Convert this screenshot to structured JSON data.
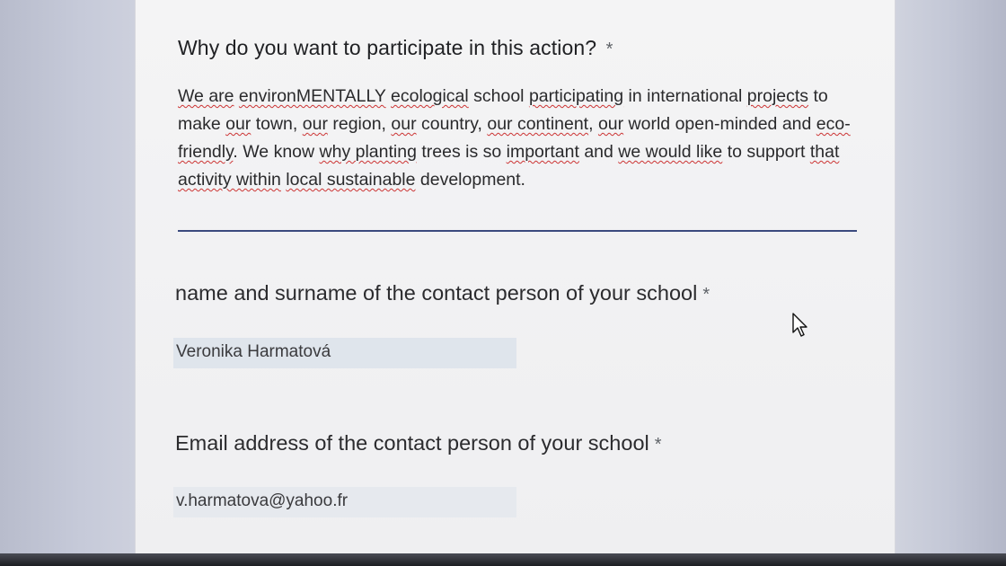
{
  "question": {
    "title": "Why do you want to participate in this action?",
    "required_mark": "*",
    "answer_segments": [
      {
        "t": "We are",
        "sq": true
      },
      {
        "t": " ",
        "sq": false
      },
      {
        "t": "environMENTALLY",
        "sq": true
      },
      {
        "t": " ",
        "sq": false
      },
      {
        "t": "ecological",
        "sq": true
      },
      {
        "t": " school ",
        "sq": false
      },
      {
        "t": "participating",
        "sq": true
      },
      {
        "t": " in international ",
        "sq": false
      },
      {
        "t": "projects",
        "sq": true
      },
      {
        "t": " to make ",
        "sq": false
      },
      {
        "t": "our",
        "sq": true
      },
      {
        "t": " town, ",
        "sq": false
      },
      {
        "t": "our",
        "sq": true
      },
      {
        "t": " region, ",
        "sq": false
      },
      {
        "t": "our",
        "sq": true
      },
      {
        "t": " country, ",
        "sq": false
      },
      {
        "t": "our continent",
        "sq": true
      },
      {
        "t": ", ",
        "sq": false
      },
      {
        "t": "our",
        "sq": true
      },
      {
        "t": " world open-minded and ",
        "sq": false
      },
      {
        "t": "eco-friendly",
        "sq": true
      },
      {
        "t": ". We know ",
        "sq": false
      },
      {
        "t": "why planting",
        "sq": true
      },
      {
        "t": " trees is so ",
        "sq": false
      },
      {
        "t": "important",
        "sq": true
      },
      {
        "t": " and ",
        "sq": false
      },
      {
        "t": "we would like",
        "sq": true
      },
      {
        "t": " to support ",
        "sq": false
      },
      {
        "t": "that",
        "sq": true
      },
      {
        "t": " ",
        "sq": false
      },
      {
        "t": "activity within",
        "sq": true
      },
      {
        "t": " ",
        "sq": false
      },
      {
        "t": "local sustainable",
        "sq": true
      },
      {
        "t": " development.",
        "sq": false
      }
    ]
  },
  "contact_name": {
    "label": "name and surname of the contact person of your school",
    "required_mark": "*",
    "value": "Veronika Harmatová"
  },
  "contact_email": {
    "label": "Email address of the contact person of your school",
    "required_mark": "*",
    "value": "v.harmatova@yahoo.fr"
  },
  "icons": {
    "cursor": "mouse-pointer-icon"
  },
  "colors": {
    "underline_active": "#3b4a7e",
    "spellcheck": "#cc3333",
    "field_bg": "#dfe5ec"
  }
}
